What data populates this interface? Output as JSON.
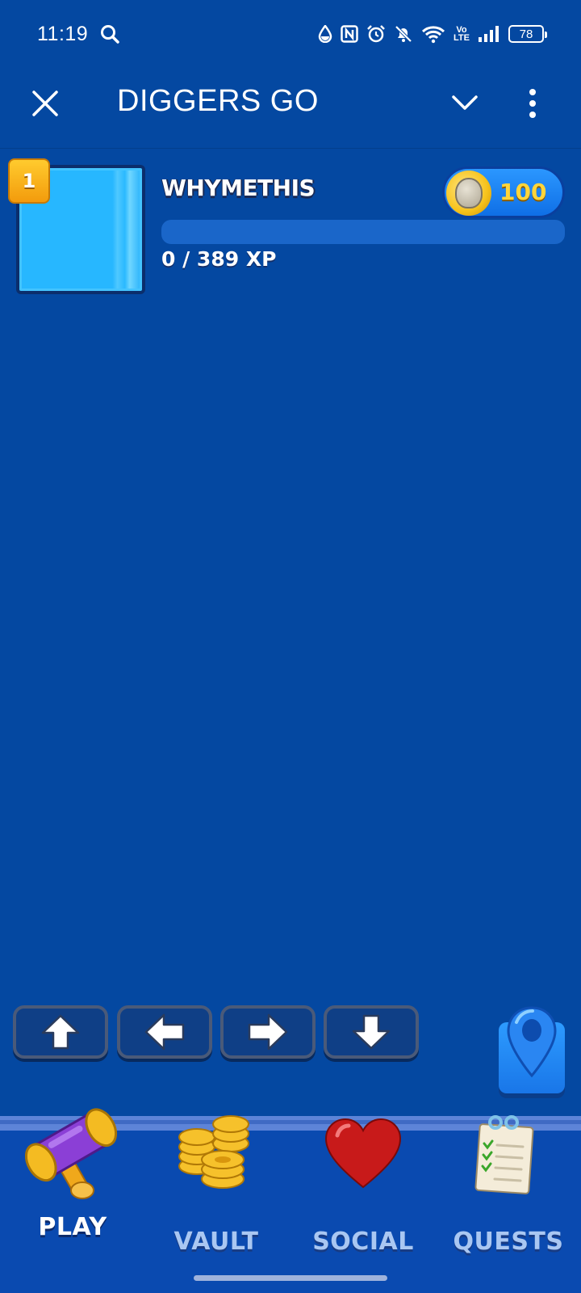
{
  "status_bar": {
    "time": "11:19",
    "volte_line1": "Vo",
    "volte_line2": "LTE",
    "battery": "78"
  },
  "app": {
    "title": "DIGGERS GO"
  },
  "player": {
    "level": "1",
    "name": "WHYMETHIS",
    "coins": "100",
    "xp_text": "0 / 389 XP",
    "xp_progress": 0
  },
  "controls": {
    "up_icon": "arrow-up-icon",
    "left_icon": "arrow-left-icon",
    "right_icon": "arrow-right-icon",
    "down_icon": "arrow-down-icon",
    "location_icon": "location-pin-icon"
  },
  "nav": {
    "items": [
      {
        "label": "PLAY",
        "icon": "hammer-icon",
        "active": true
      },
      {
        "label": "VAULT",
        "icon": "coins-icon",
        "active": false
      },
      {
        "label": "SOCIAL",
        "icon": "heart-icon",
        "active": false
      },
      {
        "label": "QUESTS",
        "icon": "notepad-icon",
        "active": false
      }
    ]
  },
  "colors": {
    "background": "#0448a1",
    "coin_text": "#ffd53b",
    "avatar": "#27b7ff",
    "level_badge": "#f39b0c"
  }
}
